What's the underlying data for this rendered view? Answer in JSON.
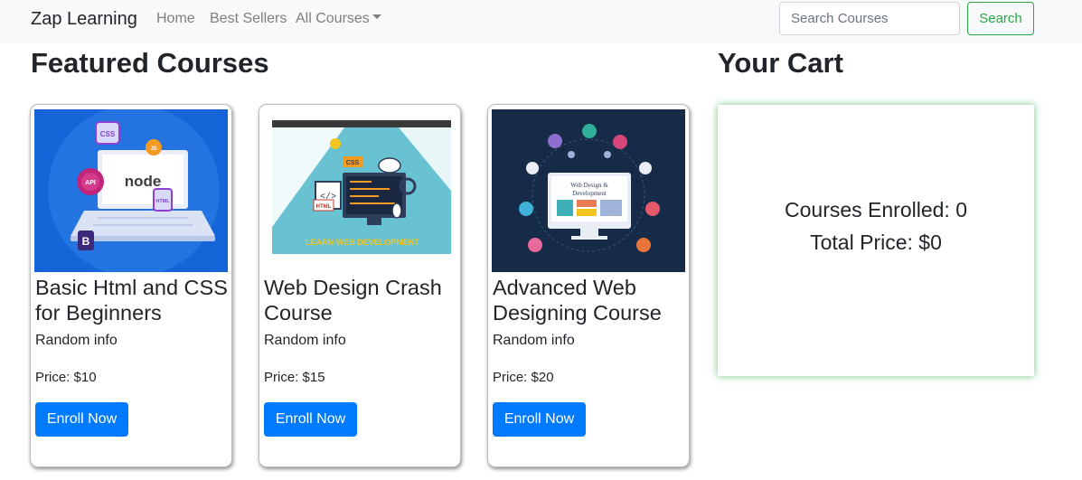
{
  "navbar": {
    "brand": "Zap Learning",
    "links": [
      "Home",
      "Best Sellers",
      "All Courses"
    ],
    "search_placeholder": "Search Courses",
    "search_button": "Search"
  },
  "featured": {
    "title": "Featured Courses",
    "courses": [
      {
        "title": "Basic Html and CSS for Beginners",
        "info": "Random info",
        "price": "Price: $10",
        "button": "Enroll Now",
        "image_labels": [
          "CSS",
          "API",
          "node",
          "HTML",
          "B",
          "JS"
        ]
      },
      {
        "title": "Web Design Crash Course",
        "info": "Random info",
        "price": "Price: $15",
        "button": "Enroll Now",
        "image_labels": [
          "CSS",
          "HTML",
          "LEARN WEB DEVELOPMENT"
        ]
      },
      {
        "title": "Advanced Web Designing Course",
        "info": "Random info",
        "price": "Price: $20",
        "button": "Enroll Now",
        "image_labels": [
          "Web Design &",
          "Development"
        ]
      }
    ]
  },
  "cart": {
    "title": "Your Cart",
    "enrolled": "Courses Enrolled: 0",
    "total": "Total Price: $0"
  },
  "colors": {
    "primary": "#007bff",
    "success": "#28a745",
    "navbar_bg": "#f8f9fa"
  }
}
